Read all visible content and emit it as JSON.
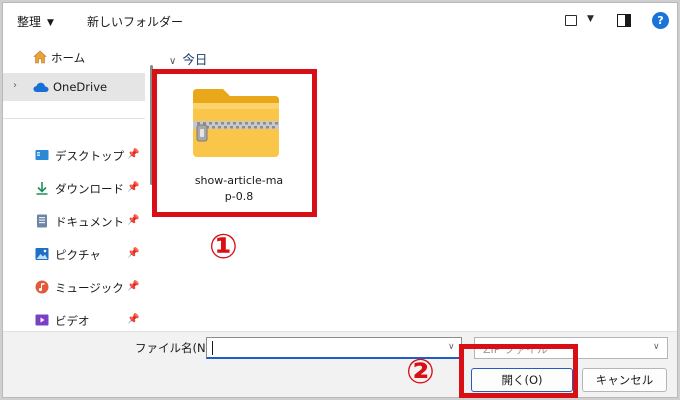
{
  "toolbar": {
    "organize_label": "整理",
    "new_folder_label": "新しいフォルダー",
    "help_label": "?"
  },
  "sidebar": {
    "items": [
      {
        "label": "ホーム",
        "icon": "home-icon"
      },
      {
        "label": "OneDrive",
        "icon": "cloud-icon",
        "selected": true
      },
      {
        "label": "デスクトップ",
        "icon": "desktop-icon",
        "pinned": true
      },
      {
        "label": "ダウンロード",
        "icon": "download-icon",
        "pinned": true
      },
      {
        "label": "ドキュメント",
        "icon": "document-icon",
        "pinned": true
      },
      {
        "label": "ピクチャ",
        "icon": "pictures-icon",
        "pinned": true
      },
      {
        "label": "ミュージック",
        "icon": "music-icon",
        "pinned": true
      },
      {
        "label": "ビデオ",
        "icon": "video-icon",
        "pinned": true
      }
    ]
  },
  "main": {
    "group_header": "今日",
    "files": [
      {
        "name_line1": "show-article-ma",
        "name_line2": "p-0.8",
        "icon": "zip-folder-icon"
      }
    ]
  },
  "annotations": {
    "badge_1": "①",
    "badge_2": "②",
    "highlight_color": "#d80f15"
  },
  "footer": {
    "filename_label": "ファイル名(N):",
    "filename_value": "",
    "filetype_value": "ZIP ファイル",
    "open_label": "開く(O)",
    "cancel_label": "キャンセル"
  }
}
